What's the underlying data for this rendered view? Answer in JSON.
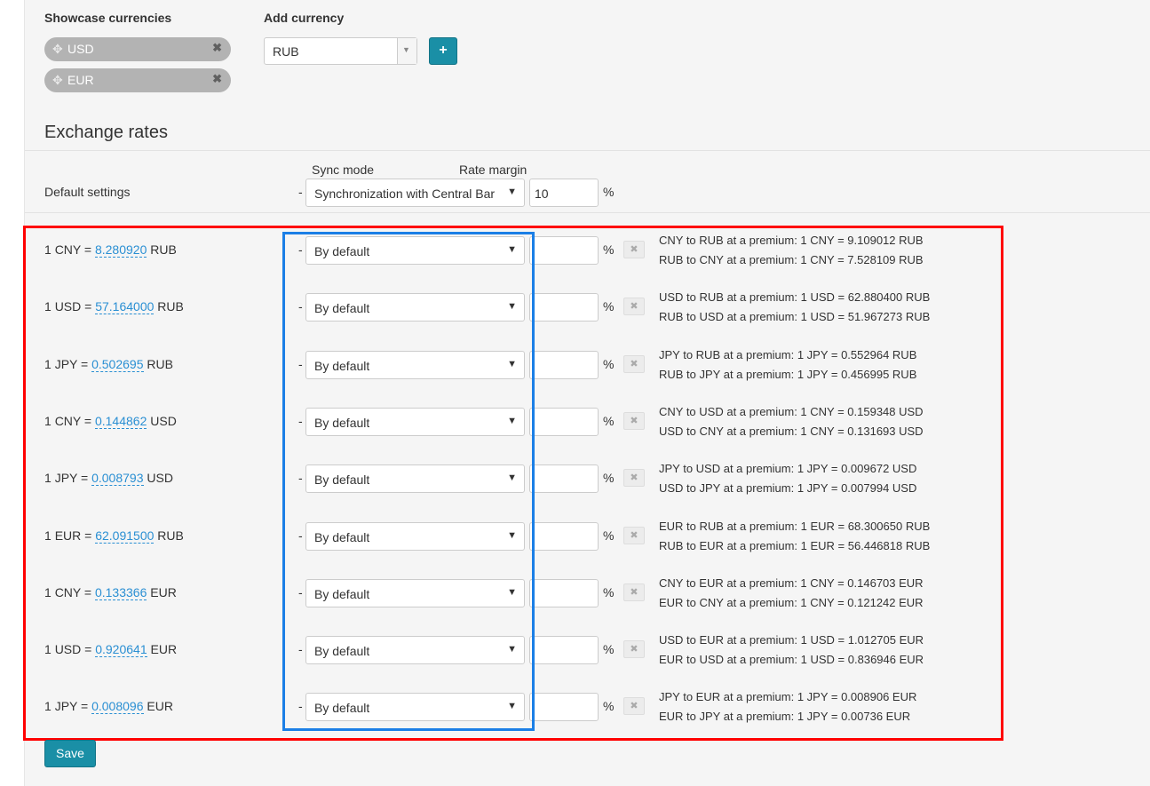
{
  "showcase": {
    "title": "Showcase currencies",
    "chips": [
      {
        "code": "USD",
        "move_icon": "move-icon",
        "remove_icon": "close-icon"
      },
      {
        "code": "EUR",
        "move_icon": "move-icon",
        "remove_icon": "close-icon"
      }
    ]
  },
  "add_currency": {
    "title": "Add currency",
    "selected": "RUB",
    "add_button_label": "+"
  },
  "exchange": {
    "title": "Exchange rates",
    "sync_mode_header": "Sync mode",
    "rate_margin_header": "Rate margin",
    "default_label": "Default settings",
    "default_sync": "Synchronization with Central Bar",
    "default_margin": "10",
    "dash": "-",
    "percent": "%",
    "rows": [
      {
        "base": "CNY",
        "rate": "8.280920",
        "quote": "RUB",
        "sync": "By default",
        "margin": "",
        "line1": "CNY to RUB at a premium: 1 CNY = 9.109012 RUB",
        "line2": "RUB to CNY at a premium: 1 CNY = 7.528109 RUB"
      },
      {
        "base": "USD",
        "rate": "57.164000",
        "quote": "RUB",
        "sync": "By default",
        "margin": "",
        "line1": "USD to RUB at a premium: 1 USD = 62.880400 RUB",
        "line2": "RUB to USD at a premium: 1 USD = 51.967273 RUB"
      },
      {
        "base": "JPY",
        "rate": "0.502695",
        "quote": "RUB",
        "sync": "By default",
        "margin": "",
        "line1": "JPY to RUB at a premium: 1 JPY = 0.552964 RUB",
        "line2": "RUB to JPY at a premium: 1 JPY = 0.456995 RUB"
      },
      {
        "base": "CNY",
        "rate": "0.144862",
        "quote": "USD",
        "sync": "By default",
        "margin": "",
        "line1": "CNY to USD at a premium: 1 CNY = 0.159348 USD",
        "line2": "USD to CNY at a premium: 1 CNY = 0.131693 USD"
      },
      {
        "base": "JPY",
        "rate": "0.008793",
        "quote": "USD",
        "sync": "By default",
        "margin": "",
        "line1": "JPY to USD at a premium: 1 JPY = 0.009672 USD",
        "line2": "USD to JPY at a premium: 1 JPY = 0.007994 USD"
      },
      {
        "base": "EUR",
        "rate": "62.091500",
        "quote": "RUB",
        "sync": "By default",
        "margin": "",
        "line1": "EUR to RUB at a premium: 1 EUR = 68.300650 RUB",
        "line2": "RUB to EUR at a premium: 1 EUR = 56.446818 RUB"
      },
      {
        "base": "CNY",
        "rate": "0.133366",
        "quote": "EUR",
        "sync": "By default",
        "margin": "",
        "line1": "CNY to EUR at a premium: 1 CNY = 0.146703 EUR",
        "line2": "EUR to CNY at a premium: 1 CNY = 0.121242 EUR"
      },
      {
        "base": "USD",
        "rate": "0.920641",
        "quote": "EUR",
        "sync": "By default",
        "margin": "",
        "line1": "USD to EUR at a premium: 1 USD = 1.012705 EUR",
        "line2": "EUR to USD at a premium: 1 USD = 0.836946 EUR"
      },
      {
        "base": "JPY",
        "rate": "0.008096",
        "quote": "EUR",
        "sync": "By default",
        "margin": "",
        "line1": "JPY to EUR at a premium: 1 JPY = 0.008906 EUR",
        "line2": "EUR to JPY at a premium: 1 JPY = 0.00736 EUR"
      }
    ]
  },
  "save_label": "Save",
  "colors": {
    "accent": "#1a8fa6",
    "link": "#2a8fd3",
    "highlight_red": "#ff0000",
    "highlight_blue": "#1b7fe6"
  }
}
